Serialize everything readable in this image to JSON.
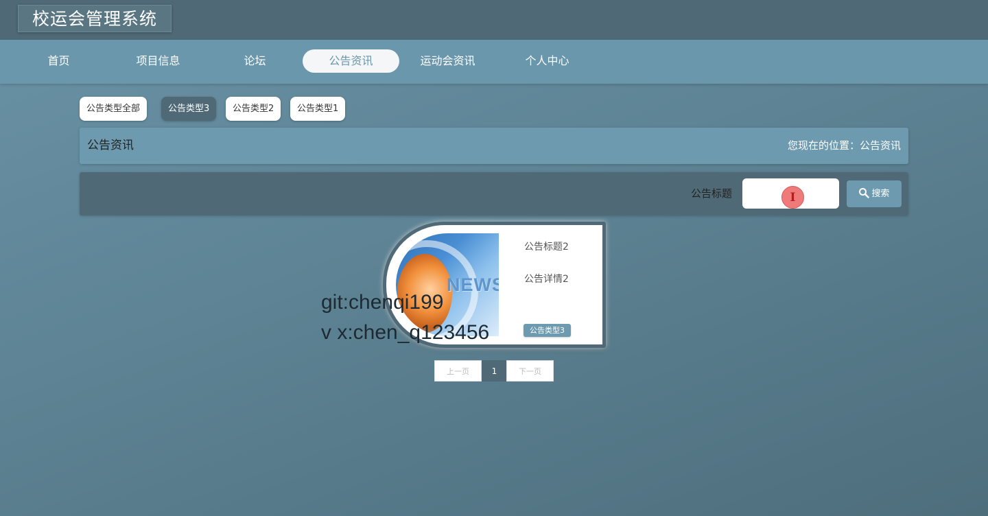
{
  "app": {
    "title": "校运会管理系统"
  },
  "nav": {
    "items": [
      {
        "label": "首页"
      },
      {
        "label": "项目信息"
      },
      {
        "label": "论坛"
      },
      {
        "label": "公告资讯"
      },
      {
        "label": "运动会资讯"
      },
      {
        "label": "个人中心"
      }
    ],
    "active": "公告资讯"
  },
  "filters": {
    "items": [
      {
        "label": "公告类型全部"
      },
      {
        "label": "公告类型3"
      },
      {
        "label": "公告类型2"
      },
      {
        "label": "公告类型1"
      }
    ],
    "active": "公告类型3"
  },
  "section": {
    "title": "公告资讯",
    "breadcrumb": "您现在的位置：公告资讯"
  },
  "search": {
    "label": "公告标题",
    "value": "",
    "button_label": "搜索",
    "cursor_glyph": "I"
  },
  "cards": [
    {
      "title": "公告标题2",
      "detail": "公告详情2",
      "type_badge": "公告类型3",
      "image_text": "NEWS"
    }
  ],
  "watermark": {
    "line1": "git:chenqi199",
    "line2": "v x:chen_q123456"
  },
  "pagination": {
    "prev_label": "上一页",
    "current": "1",
    "next_label": "下一页"
  },
  "colors": {
    "header": "#4f6a76",
    "nav": "#6a97ac",
    "accent": "#6d9aaf",
    "active_chip": "#4f6a76"
  }
}
